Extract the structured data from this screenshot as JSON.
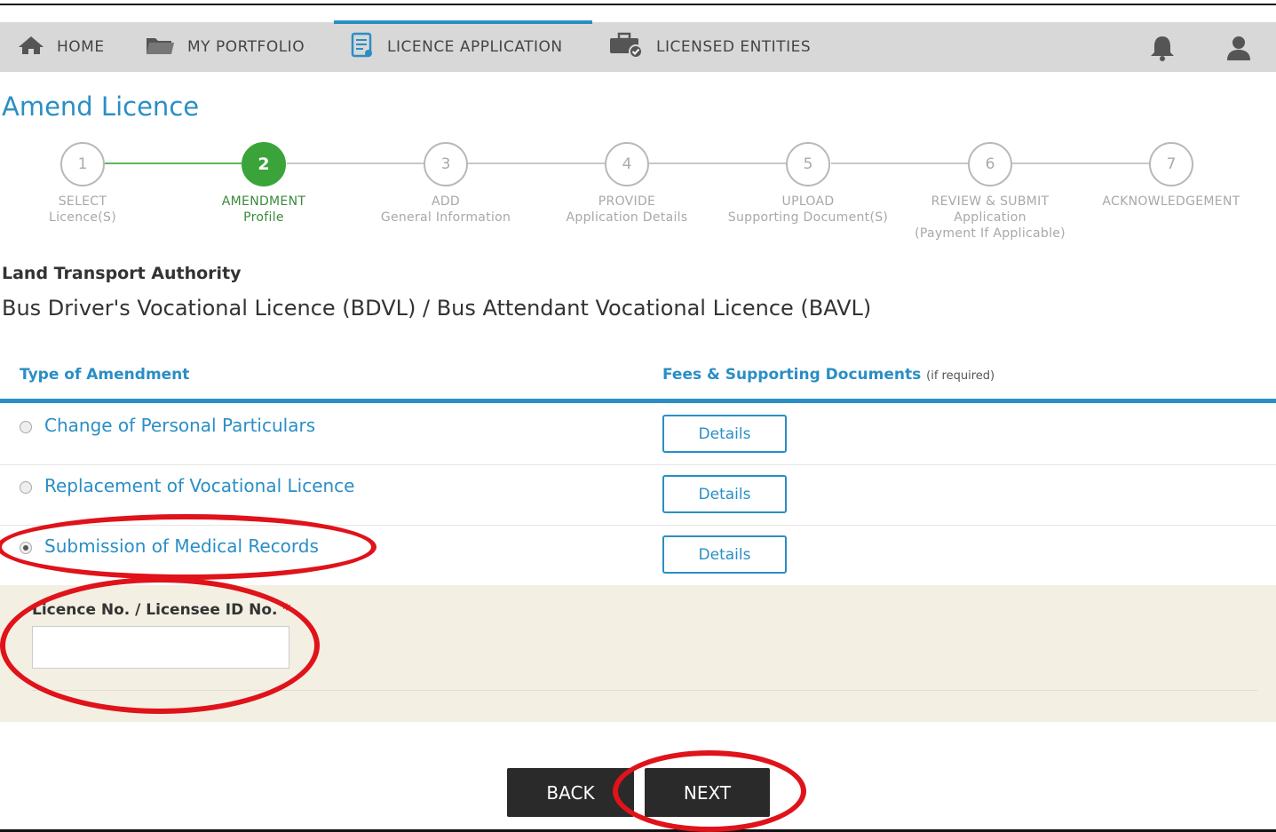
{
  "nav": {
    "items": [
      {
        "label": "HOME",
        "icon": "home-icon"
      },
      {
        "label": "MY PORTFOLIO",
        "icon": "folder-icon"
      },
      {
        "label": "LICENCE APPLICATION",
        "icon": "document-icon"
      },
      {
        "label": "LICENSED ENTITIES",
        "icon": "briefcase-check-icon"
      }
    ],
    "active_index": 2,
    "right_icons": [
      "bell-icon",
      "user-icon"
    ]
  },
  "page": {
    "title": "Amend Licence"
  },
  "stepper": {
    "current_step": 2,
    "steps": [
      {
        "number": "1",
        "line1": "SELECT",
        "line2": "Licence(S)",
        "line3": ""
      },
      {
        "number": "2",
        "line1": "AMENDMENT",
        "line2": "Profile",
        "line3": ""
      },
      {
        "number": "3",
        "line1": "ADD",
        "line2": "General Information",
        "line3": ""
      },
      {
        "number": "4",
        "line1": "PROVIDE",
        "line2": "Application Details",
        "line3": ""
      },
      {
        "number": "5",
        "line1": "UPLOAD",
        "line2": "Supporting Document(S)",
        "line3": ""
      },
      {
        "number": "6",
        "line1": "REVIEW & SUBMIT",
        "line2": "Application",
        "line3": "(Payment If Applicable)"
      },
      {
        "number": "7",
        "line1": "ACKNOWLEDGEMENT",
        "line2": "",
        "line3": ""
      }
    ]
  },
  "authority": "Land Transport Authority",
  "licence_name": "Bus Driver's Vocational Licence (BDVL) / Bus Attendant Vocational Licence (BAVL)",
  "table": {
    "col1_header": "Type of Amendment",
    "col2_header": "Fees & Supporting Documents",
    "col2_note": "(if required)",
    "rows": [
      {
        "label": "Change of Personal Particulars",
        "button": "Details",
        "selected": false
      },
      {
        "label": "Replacement of Vocational Licence",
        "button": "Details",
        "selected": false
      },
      {
        "label": "Submission of Medical Records",
        "button": "Details",
        "selected": true
      }
    ]
  },
  "form": {
    "licence_label": "Licence No. / Licensee ID No.",
    "required_mark": "*",
    "licence_value": ""
  },
  "actions": {
    "back": "BACK",
    "next": "NEXT"
  },
  "colors": {
    "accent": "#2a8ec5",
    "step_active": "#3aa43a",
    "annotation": "#e0121a",
    "panel": "#f3efe3"
  }
}
